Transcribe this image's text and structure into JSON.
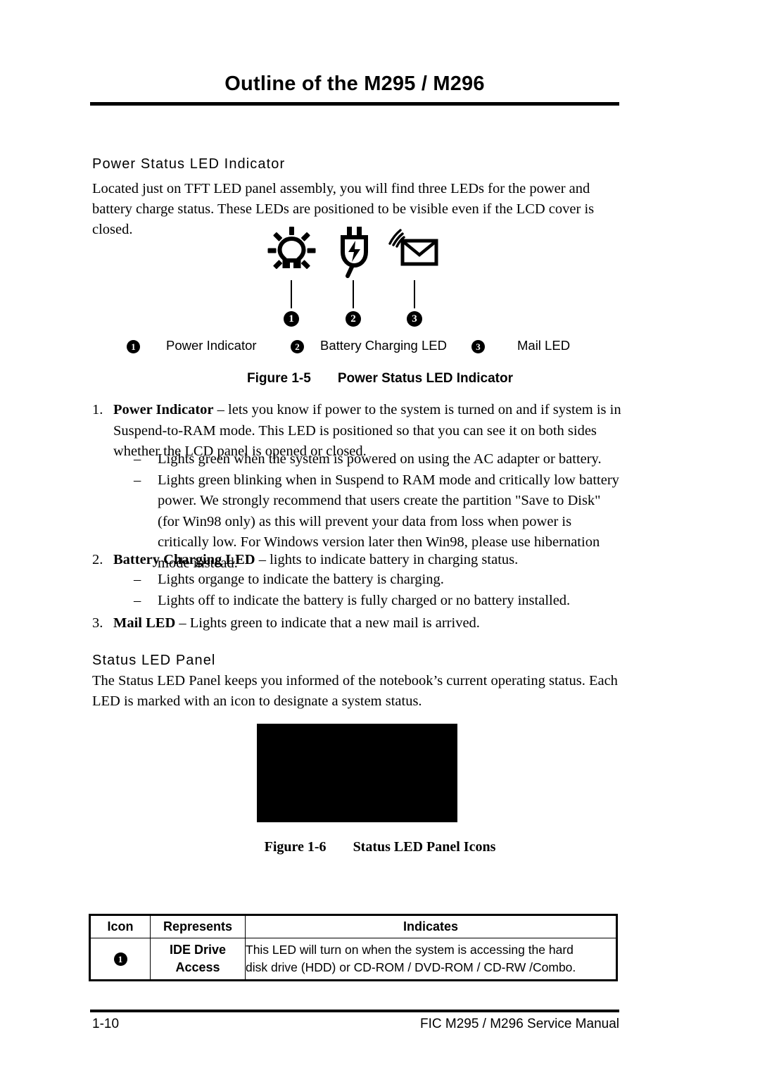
{
  "header": {
    "title": "Outline of the M295 / M296"
  },
  "sections": {
    "power": {
      "heading": "Power Status LED Indicator",
      "intro": "Located just on TFT LED panel assembly, you will find three LEDs for the power and battery charge status. These LEDs are positioned to be visible even if the LCD cover is closed."
    },
    "status": {
      "heading": "Status LED Panel",
      "intro": "The Status LED Panel keeps you informed of the notebook’s current operating status. Each LED is marked with an icon to designate a system status."
    }
  },
  "figure_1_5": {
    "icons": [
      {
        "number": "1",
        "icon": "sun-bulb-icon",
        "label": "Power Indicator"
      },
      {
        "number": "2",
        "icon": "power-plug-icon",
        "label": "Battery Charging LED"
      },
      {
        "number": "3",
        "icon": "mail-envelope-icon",
        "label": "Mail LED"
      }
    ],
    "caption_number": "Figure 1-5",
    "caption_title": "Power Status LED Indicator"
  },
  "figure_1_6": {
    "caption_number": "Figure 1-6",
    "caption_title": "Status LED Panel Icons"
  },
  "list": {
    "item1": {
      "marker": "1.",
      "bold": "Power Indicator",
      "text": " – lets you know if power to the system is turned on and if system is in Suspend-to-RAM mode. This LED is positioned so that you can see it on both sides whether the LCD panel is opened or closed.",
      "bullets": [
        "Lights green when the system is powered on using the AC adapter or battery.",
        "Lights green blinking when in Suspend to RAM mode and critically low battery power. We strongly recommend that users create the partition \"Save to Disk\" (for Win98 only) as this will prevent your data from loss when power is critically low. For Windows version later then Win98, please use hibernation mode instead."
      ]
    },
    "item2": {
      "marker": "2.",
      "bold": "Battery Charging LED",
      "text": " – lights to indicate battery in charging status.",
      "bullets": [
        "Lights organge to indicate the battery is charging.",
        "Lights off to indicate the battery is fully charged or no battery installed."
      ]
    },
    "item3": {
      "marker": "3.",
      "bold": "Mail LED",
      "text": " – Lights green to indicate that a new mail is arrived."
    },
    "dash": "–"
  },
  "table": {
    "headers": [
      "Icon",
      "Represents",
      "Indicates"
    ],
    "rows": [
      {
        "icon_number": "1",
        "represents_line1": "IDE Drive",
        "represents_line2": "Access",
        "indicates_line1": "This LED will turn on when the system is accessing the hard",
        "indicates_line2": "disk drive (HDD) or CD-ROM / DVD-ROM / CD-RW /Combo."
      }
    ]
  },
  "footer": {
    "page_number": "1-10",
    "manual_title": "FIC M295 / M296 Service Manual"
  }
}
